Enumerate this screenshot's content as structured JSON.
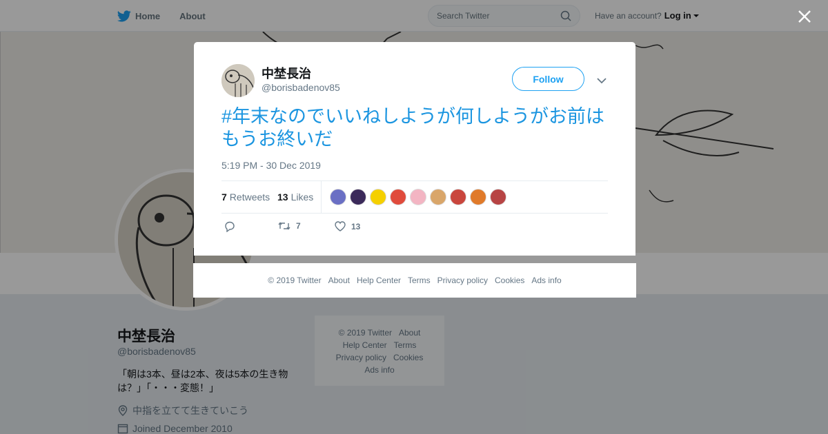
{
  "nav": {
    "home_label": "Home",
    "about_label": "About",
    "search_placeholder": "Search Twitter",
    "account_prompt": "Have an account?",
    "login_label": "Log in"
  },
  "profile": {
    "name": "中埜長治",
    "handle": "@borisbadenov85",
    "bio": "「朝は3本、昼は2本、夜は5本の生き物は？」「・・・変態！」",
    "location": "中指を立てて生きていこう",
    "joined": "Joined December 2010"
  },
  "side_footer": {
    "links": [
      "© 2019 Twitter",
      "About",
      "Help Center",
      "Terms",
      "Privacy policy",
      "Cookies",
      "Ads info"
    ]
  },
  "tweet": {
    "author_name": "中埜長治",
    "author_handle": "@borisbadenov85",
    "follow_label": "Follow",
    "text": "#年末なのでいいねしようが何しようがお前はもうお終いだ",
    "timestamp": "5:19 PM - 30 Dec 2019",
    "retweets_count": "7",
    "retweets_label": "Retweets",
    "likes_count": "13",
    "likes_label": "Likes",
    "action_retweet_count": "7",
    "action_like_count": "13",
    "likers": [
      {
        "color": "#6a6fc4"
      },
      {
        "color": "#3b2a5a"
      },
      {
        "color": "#f5d000"
      },
      {
        "color": "#e04b3c"
      },
      {
        "color": "#f3b5c3"
      },
      {
        "color": "#d9a66a"
      },
      {
        "color": "#c9463d"
      },
      {
        "color": "#e07a2a"
      },
      {
        "color": "#b74444"
      }
    ]
  },
  "modal_footer": {
    "links": [
      "© 2019 Twitter",
      "About",
      "Help Center",
      "Terms",
      "Privacy policy",
      "Cookies",
      "Ads info"
    ]
  },
  "colors": {
    "brand": "#1da1f2",
    "link": "#1b95e0",
    "overlay": "rgba(0,0,0,0.40)"
  }
}
